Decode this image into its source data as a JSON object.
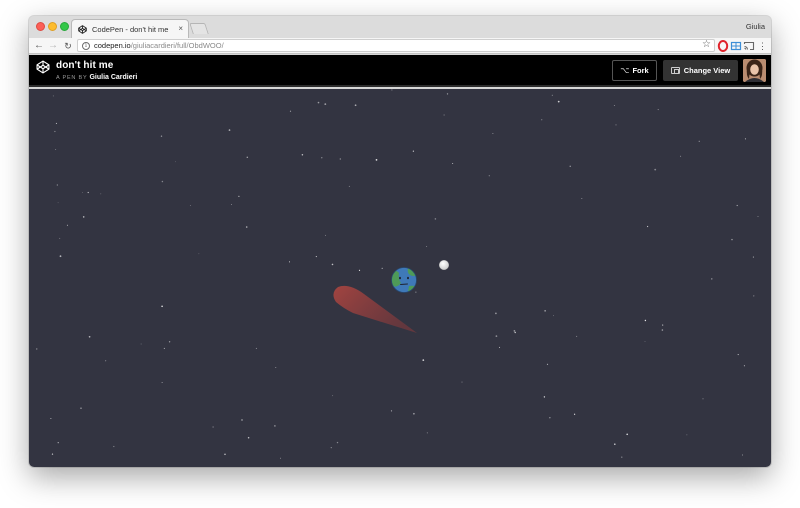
{
  "browser": {
    "tab_title": "CodePen - don't hit me",
    "tab_close_glyph": "×",
    "profile_name": "Giulia",
    "url_host": "codepen.io",
    "url_path": "/giuliacardieri/full/ObdWOO/",
    "icons": [
      "back-arrow-icon",
      "forward-arrow-icon",
      "reload-icon",
      "info-icon",
      "star-icon",
      "opera-icon",
      "extension-icon",
      "cast-icon",
      "menu-icon"
    ]
  },
  "codepen": {
    "pen_title": "don't hit me",
    "pen_by": "A PEN BY",
    "author": "Giulia Cardieri",
    "fork_label": "Fork",
    "change_view_label": "Change View"
  },
  "colors": {
    "stage_background": "#333441",
    "header_background": "#000000",
    "comet": "#a3453f",
    "moon": "#e2e2e2",
    "earth_water": "#3f79b8",
    "earth_land": "#4e9a58"
  }
}
